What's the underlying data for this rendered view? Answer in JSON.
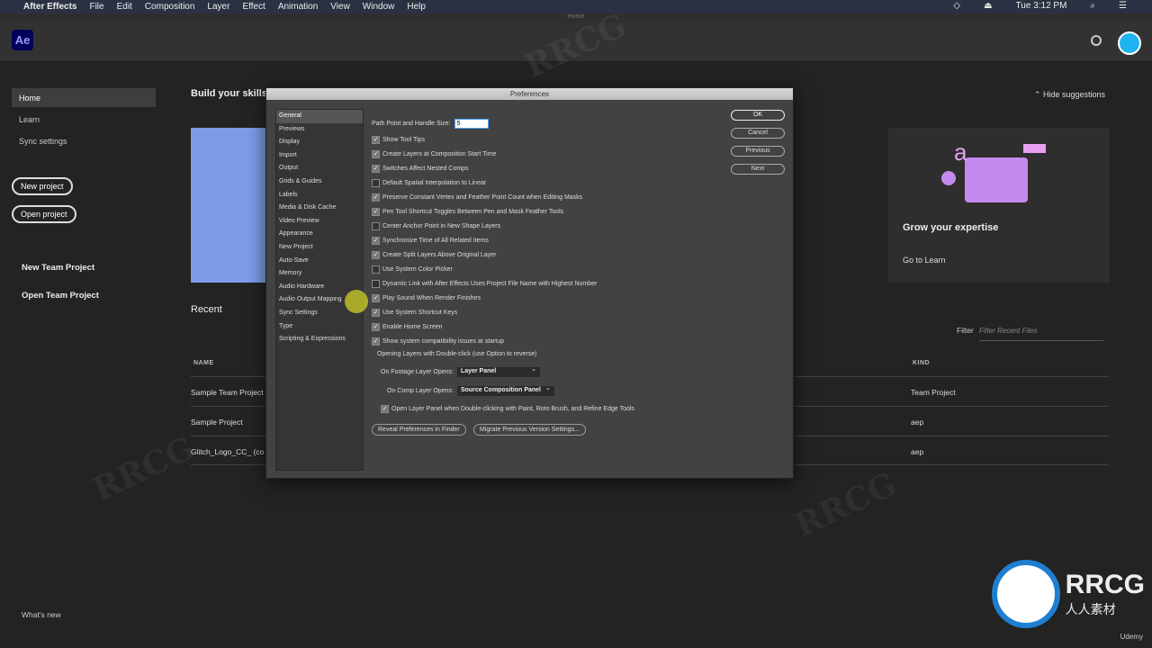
{
  "menubar": {
    "app": "After Effects",
    "items": [
      "File",
      "Edit",
      "Composition",
      "Layer",
      "Effect",
      "Animation",
      "View",
      "Window",
      "Help"
    ],
    "clock": "Tue 3:12 PM"
  },
  "window_title": "Home",
  "header": {
    "logo": "Ae",
    "accent": "#1fb4f0"
  },
  "sidebar": {
    "nav": [
      "Home",
      "Learn",
      "Sync settings"
    ],
    "new_project": "New project",
    "open_project": "Open project",
    "new_team": "New Team Project",
    "open_team": "Open Team Project",
    "whats_new": "What's new"
  },
  "main": {
    "title": "Build your skills",
    "hide": "Hide suggestions",
    "card3_title": "Grow your expertise",
    "card3_link": "Go to Learn",
    "recent": "Recent",
    "filter_label": "Filter",
    "filter_placeholder": "Filter Recent Files",
    "col_name": "NAME",
    "col_kind": "KIND",
    "rows": [
      {
        "name": "Sample Team Project",
        "kind": "Team Project"
      },
      {
        "name": "Sample Project",
        "kind": "aep"
      },
      {
        "name": "Glitch_Logo_CC_ (co",
        "kind": "aep"
      }
    ]
  },
  "dialog": {
    "title": "Preferences",
    "categories": [
      "General",
      "Previews",
      "Display",
      "Import",
      "Output",
      "Grids & Guides",
      "Labels",
      "Media & Disk Cache",
      "Video Preview",
      "Appearance",
      "New Project",
      "Auto-Save",
      "Memory",
      "Audio Hardware",
      "Audio Output Mapping",
      "Sync Settings",
      "Type",
      "Scripting & Expressions"
    ],
    "path_label": "Path Point and Handle Size:",
    "path_value": "5",
    "options": [
      {
        "label": "Show Tool Tips",
        "checked": true
      },
      {
        "label": "Create Layers at Composition Start Time",
        "checked": true
      },
      {
        "label": "Switches Affect Nested Comps",
        "checked": true
      },
      {
        "label": "Default Spatial Interpolation to Linear",
        "checked": false
      },
      {
        "label": "Preserve Constant Vertex and Feather Point Count when Editing Masks",
        "checked": true
      },
      {
        "label": "Pen Tool Shortcut Toggles Between Pen and Mask Feather Tools",
        "checked": true
      },
      {
        "label": "Center Anchor Point in New Shape Layers",
        "checked": false
      },
      {
        "label": "Synchronize Time of All Related Items",
        "checked": true
      },
      {
        "label": "Create Split Layers Above Original Layer",
        "checked": true
      },
      {
        "label": "Use System Color Picker",
        "checked": false
      },
      {
        "label": "Dynamic Link with After Effects Uses Project File Name with Highest Number",
        "checked": false
      },
      {
        "label": "Play Sound When Render Finishes",
        "checked": true
      },
      {
        "label": "Use System Shortcut Keys",
        "checked": true
      },
      {
        "label": "Enable Home Screen",
        "checked": true
      },
      {
        "label": "Show system compatibility issues at startup",
        "checked": true
      }
    ],
    "group_label": "Opening Layers with Double-click (use Option to reverse)",
    "footage_label": "On Footage Layer Opens:",
    "footage_value": "Layer Panel",
    "comp_label": "On Comp Layer Opens:",
    "comp_value": "Source Composition Panel",
    "open_layer_panel": "Open Layer Panel when Double-clicking with Paint, Roto Brush, and Refine Edge Tools",
    "ok": "OK",
    "cancel": "Cancel",
    "previous": "Previous",
    "next": "Next",
    "reveal": "Reveal Preferences in Finder",
    "migrate": "Migrate Previous Version Settings..."
  },
  "watermark": {
    "text": "RRCG",
    "sub": "人人素材",
    "udemy": "Udemy"
  }
}
